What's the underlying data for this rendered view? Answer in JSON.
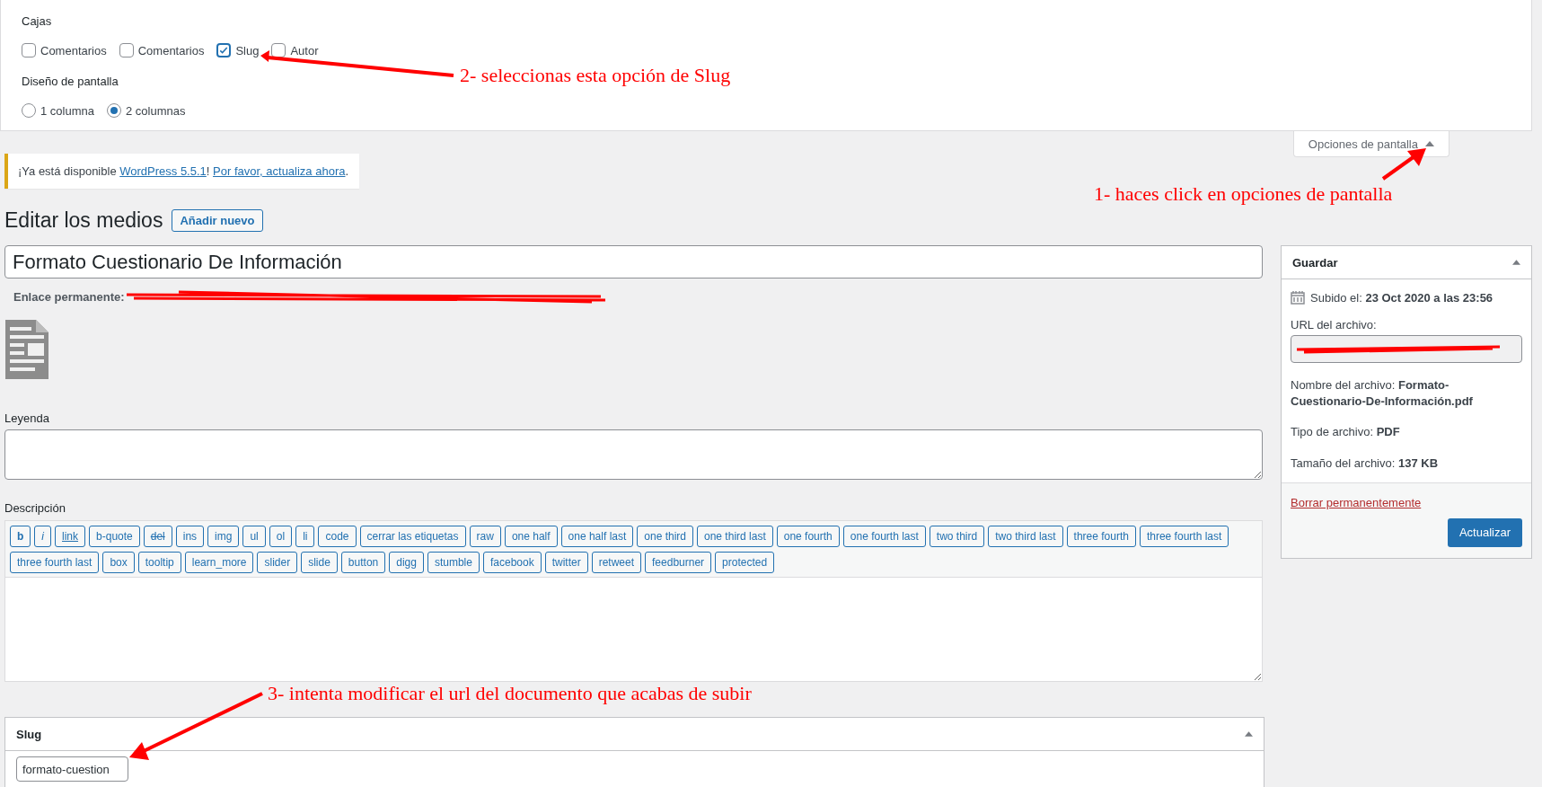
{
  "screen_options": {
    "boxes_heading": "Cajas",
    "boxes": [
      {
        "label": "Comentarios",
        "checked": false
      },
      {
        "label": "Comentarios",
        "checked": false
      },
      {
        "label": "Slug",
        "checked": true
      },
      {
        "label": "Autor",
        "checked": false
      }
    ],
    "layout_heading": "Diseño de pantalla",
    "layout": [
      {
        "label": "1 columna",
        "selected": false
      },
      {
        "label": "2 columnas",
        "selected": true
      }
    ]
  },
  "screen_options_tab": {
    "label": "Opciones de pantalla"
  },
  "notice": {
    "before": "¡Ya está disponible ",
    "link_1": "WordPress 5.5.1",
    "middle": "! ",
    "link_2": "Por favor, actualiza ahora",
    "after": "."
  },
  "heading": "Editar los medios",
  "add_new": "Añadir nuevo",
  "title_field": {
    "value": "Formato Cuestionario De Información"
  },
  "permalink": {
    "label": "Enlace permanente:"
  },
  "caption": {
    "label": "Leyenda"
  },
  "description": {
    "label": "Descripción",
    "buttons": [
      {
        "label": "b",
        "kind": "bold"
      },
      {
        "label": "i",
        "kind": "italic"
      },
      {
        "label": "link",
        "kind": "link"
      },
      {
        "label": "b-quote",
        "kind": "plain"
      },
      {
        "label": "del",
        "kind": "strike"
      },
      {
        "label": "ins",
        "kind": "plain"
      },
      {
        "label": "img",
        "kind": "plain"
      },
      {
        "label": "ul",
        "kind": "plain"
      },
      {
        "label": "ol",
        "kind": "plain"
      },
      {
        "label": "li",
        "kind": "plain"
      },
      {
        "label": "code",
        "kind": "plain"
      },
      {
        "label": "cerrar las etiquetas",
        "kind": "plain"
      },
      {
        "label": "raw",
        "kind": "plain"
      },
      {
        "label": "one half",
        "kind": "plain"
      },
      {
        "label": "one half last",
        "kind": "plain"
      },
      {
        "label": "one third",
        "kind": "plain"
      },
      {
        "label": "one third last",
        "kind": "plain"
      },
      {
        "label": "one fourth",
        "kind": "plain"
      },
      {
        "label": "one fourth last",
        "kind": "plain"
      },
      {
        "label": "two third",
        "kind": "plain"
      },
      {
        "label": "two third last",
        "kind": "plain"
      },
      {
        "label": "three fourth",
        "kind": "plain"
      },
      {
        "label": "three fourth last",
        "kind": "plain"
      },
      {
        "label": "three fourth last",
        "kind": "plain"
      },
      {
        "label": "box",
        "kind": "plain"
      },
      {
        "label": "tooltip",
        "kind": "plain"
      },
      {
        "label": "learn_more",
        "kind": "plain"
      },
      {
        "label": "slider",
        "kind": "plain"
      },
      {
        "label": "slide",
        "kind": "plain"
      },
      {
        "label": "button",
        "kind": "plain"
      },
      {
        "label": "digg",
        "kind": "plain"
      },
      {
        "label": "stumble",
        "kind": "plain"
      },
      {
        "label": "facebook",
        "kind": "plain"
      },
      {
        "label": "twitter",
        "kind": "plain"
      },
      {
        "label": "retweet",
        "kind": "plain"
      },
      {
        "label": "feedburner",
        "kind": "plain"
      },
      {
        "label": "protected",
        "kind": "plain"
      }
    ]
  },
  "slug_box": {
    "title": "Slug",
    "value": "formato-cuestion"
  },
  "save_box": {
    "title": "Guardar",
    "uploaded": "Subido el: **23 Oct 2020 a las 23:56**",
    "url_label": "URL del archivo:",
    "file_name": "Nombre del archivo: **Formato-Cuestionario-De-Información.pdf**",
    "file_type": "Tipo de archivo: **PDF**",
    "file_size": "Tamaño del archivo: **137 KB**",
    "delete": "Borrar permanentemente",
    "update": "Actualizar"
  },
  "annotations": [
    {
      "text": "2- seleccionas esta opción de Slug"
    },
    {
      "text": "1- haces click en opciones de pantalla"
    },
    {
      "text": "3- intenta modificar el url del documento que acabas de subir"
    }
  ]
}
